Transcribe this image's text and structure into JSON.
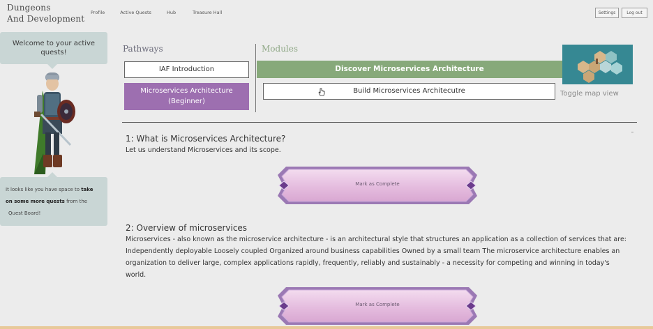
{
  "app": {
    "brand_line1": "Dungeons",
    "brand_line2": "And Development"
  },
  "nav": {
    "items": [
      "Profile",
      "Active Quests",
      "Hub",
      "Treasure Hall"
    ]
  },
  "top_right": {
    "settings_label": "Settings",
    "logout_label": "Log out"
  },
  "sidebar": {
    "welcome_text": "Welcome to your active quests!",
    "hint_prefix": "It looks like you have space to ",
    "hint_bold1": "take",
    "hint_bold2": "on some more quests",
    "hint_mid": " from the",
    "hint_end": "Quest Board!"
  },
  "pathways": {
    "label": "Pathways",
    "items": [
      {
        "label": "IAF Introduction",
        "selected": false
      },
      {
        "label": "Microservices Architecture (Beginner)",
        "selected": true
      }
    ]
  },
  "modules": {
    "label": "Modules",
    "items": [
      {
        "label": "Discover Microservices Architecture",
        "selected": true
      },
      {
        "label": "Build Microservices Architecutre",
        "selected": false
      }
    ]
  },
  "map": {
    "toggle_label": "Toggle map view"
  },
  "quests": [
    {
      "title": "1: What is Microservices Architecture?",
      "description": "Let us understand Microservices and its scope.",
      "button_label": "Mark as Complete"
    },
    {
      "title": "2: Overview of microservices",
      "description": "Microservices - also known as the microservice architecture - is an architectural style that structures an application as a collection of services that are: Independently deployable Loosely coupled Organized around business capabilities Owned by a small team The microservice architecture enables an organization to deliver large, complex applications rapidly, frequently, reliably and sustainably - a necessity for competing and winning in today's world.",
      "button_label": "Mark as Complete"
    }
  ],
  "colors": {
    "pathway_selected": "#9d6fb0",
    "module_selected": "#87a97a",
    "sidebar_panel": "#c9d6d5",
    "modules_label": "#8fa886",
    "button_pink": "#e9c3e3",
    "button_frame": "#9b79b4"
  },
  "icons": {
    "cursor": "hand-pointer-icon",
    "map_thumbnail": "hex-map-thumbnail",
    "hero": "elf-knight-avatar"
  }
}
